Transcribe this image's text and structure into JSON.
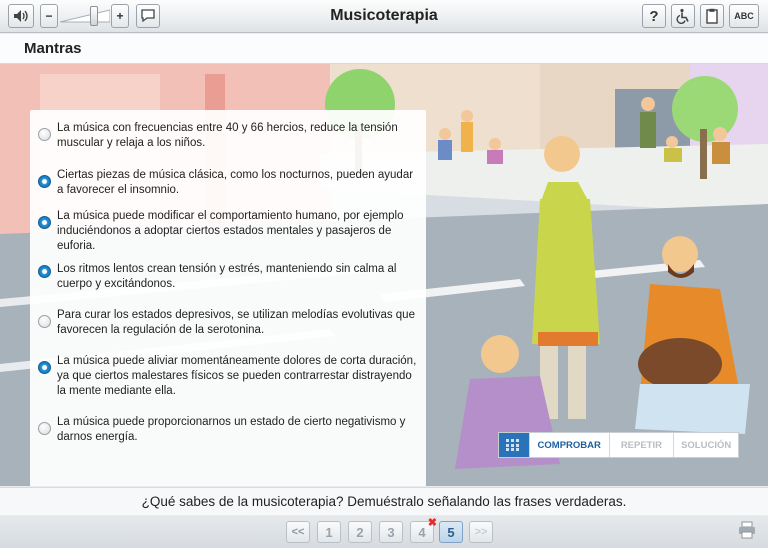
{
  "app": {
    "title": "Musicoterapia"
  },
  "toolbar": {
    "volume_icon": "speaker-icon",
    "minus": "−",
    "plus": "+",
    "subtitles_icon": "speech-bubble-icon",
    "help": "?",
    "accessibility_icon": "wheelchair-icon",
    "notes_icon": "clipboard-icon",
    "abc": "ABC"
  },
  "section": {
    "title": "Mantras"
  },
  "options": [
    {
      "text": "La música con frecuencias entre 40 y 66 hercios, reduce la tensión muscular y relaja a los niños.",
      "selected": false
    },
    {
      "text": "Ciertas piezas de música clásica, como los nocturnos, pueden ayudar a favorecer el insomnio.",
      "selected": true
    },
    {
      "text": "La música puede modificar el comportamiento humano, por ejemplo induciéndonos a adoptar ciertos estados mentales y pasajeros de euforia.",
      "selected": true
    },
    {
      "text": "Los ritmos lentos crean tensión y estrés, manteniendo sin calma al cuerpo y excitándonos.",
      "selected": true
    },
    {
      "text": "Para curar los estados depresivos, se utilizan melodías evolutivas que favorecen la regulación de la serotonina.",
      "selected": false
    },
    {
      "text": "La música puede aliviar momentáneamente dolores de corta duración, ya que ciertos malestares físicos se pueden contrarrestar distrayendo la mente mediante ella.",
      "selected": true
    },
    {
      "text": "La música puede proporcionarnos un estado de cierto negativismo y darnos energía.",
      "selected": false
    }
  ],
  "actions": {
    "check": "COMPROBAR",
    "repeat": "REPETIR",
    "solution": "SOLUCIÓN"
  },
  "statement": "¿Qué sabes de la musicoterapia? Demuéstralo señalando las frases verdaderas.",
  "pager": {
    "first": "<<",
    "pages": [
      "1",
      "2",
      "3",
      "4",
      "5"
    ],
    "current": "5",
    "wrong": "4",
    "last": ">>"
  },
  "colors": {
    "accent": "#2b73b8",
    "selected_radio": "#1f8fd6",
    "error": "#e0302c"
  }
}
